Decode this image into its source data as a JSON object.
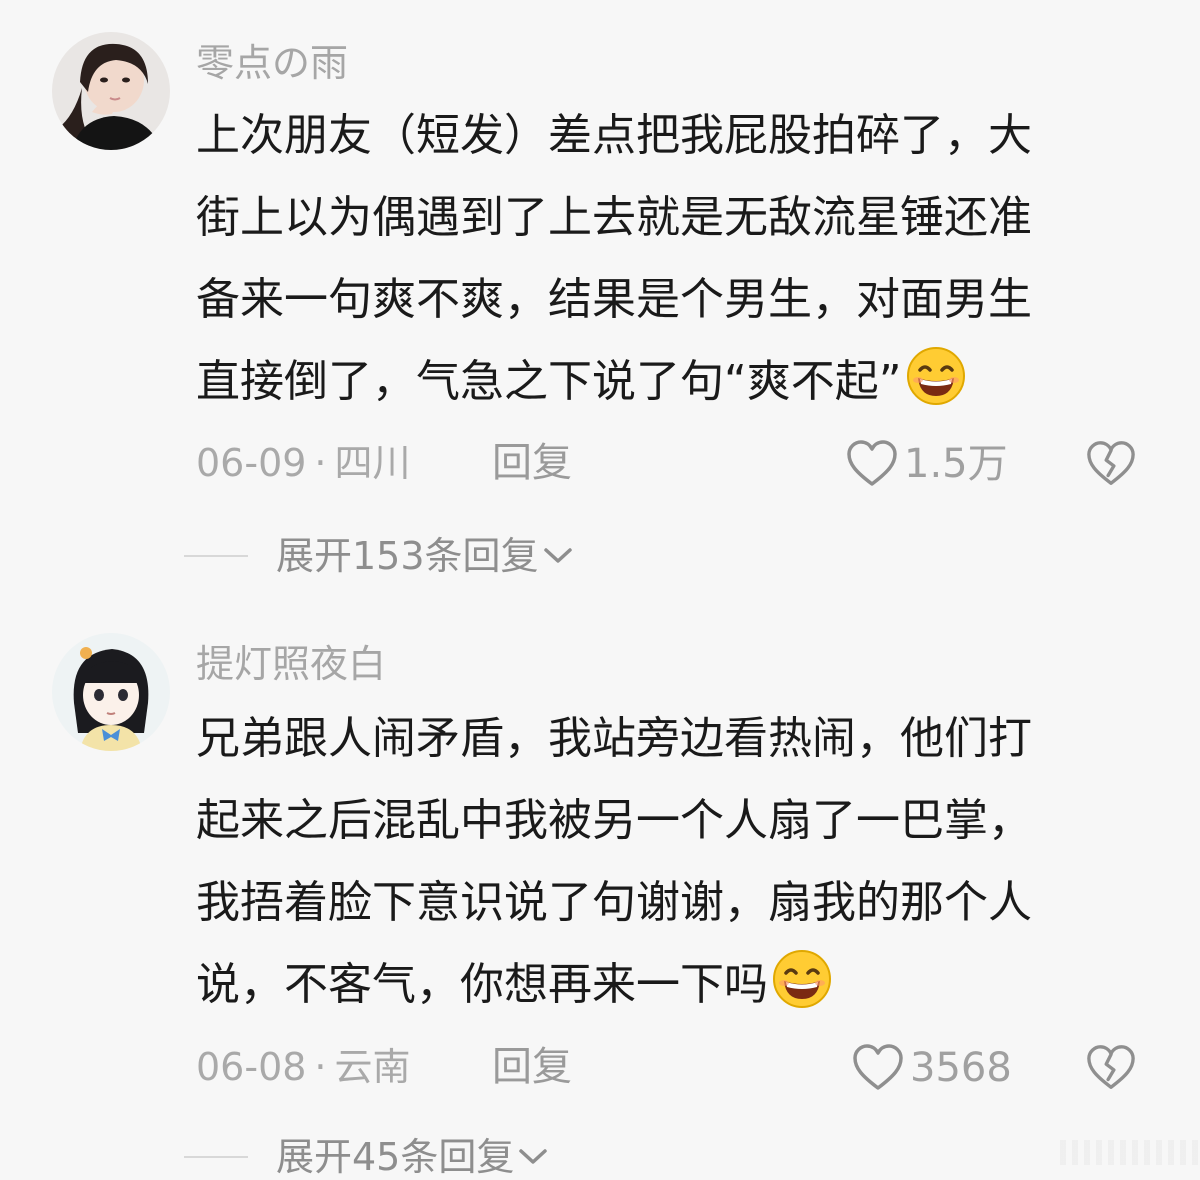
{
  "comments": [
    {
      "username": "零点の雨",
      "lines": [
        "上次朋友（短发）差点把我屁股拍碎了，大",
        "街上以为偶遇到了上去就是无敌流星锤还准",
        "备来一句爽不爽，结果是个男生，对面男生",
        "直接倒了，气急之下说了句“爽不起”"
      ],
      "emoji": "grinning-squint-emoji",
      "date": "06-09",
      "separator": "·",
      "location": "四川",
      "reply_label": "回复",
      "likes": "1.5万",
      "expand_label": "展开153条回复"
    },
    {
      "username": "提灯照夜白",
      "lines": [
        "兄弟跟人闹矛盾，我站旁边看热闹，他们打",
        "起来之后混乱中我被另一个人扇了一巴掌，",
        "我捂着脸下意识说了句谢谢，扇我的那个人",
        "说，不客气，你想再来一下吗"
      ],
      "emoji": "grinning-squint-emoji",
      "date": "06-08",
      "separator": "·",
      "location": "云南",
      "reply_label": "回复",
      "likes": "3568",
      "expand_label": "展开45条回复"
    }
  ],
  "colors": {
    "background": "#f7f7f7",
    "text": "#1a1a1a",
    "muted": "#a6a6a6",
    "emoji_face": "#ffcc33"
  }
}
